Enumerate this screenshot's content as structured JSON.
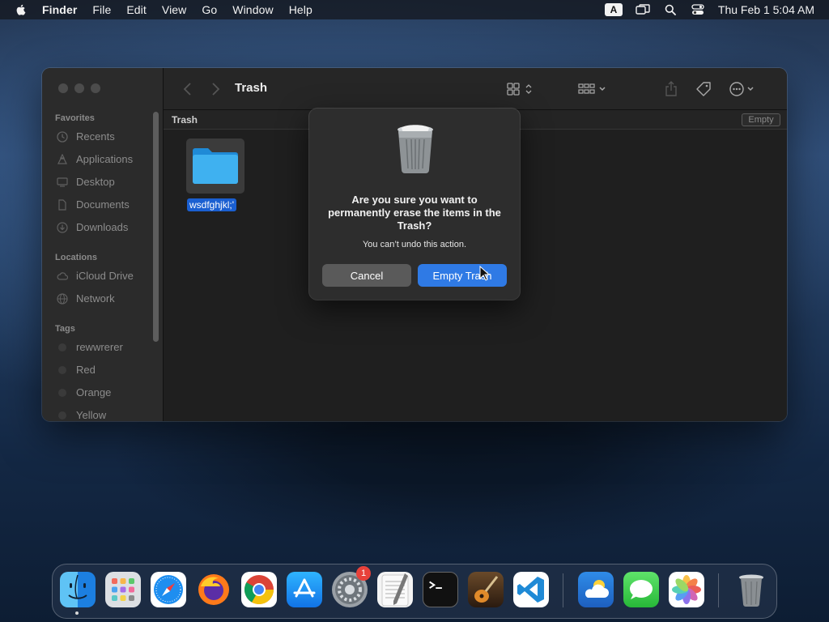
{
  "menubar": {
    "apple_icon": "apple-logo-icon",
    "app_name": "Finder",
    "menus": [
      "File",
      "Edit",
      "View",
      "Go",
      "Window",
      "Help"
    ],
    "input_source": "A",
    "clock": "Thu Feb 1  5:04 AM"
  },
  "window": {
    "title": "Trash",
    "sidebar": {
      "favorites_header": "Favorites",
      "favorites": [
        "Recents",
        "Applications",
        "Desktop",
        "Documents",
        "Downloads"
      ],
      "locations_header": "Locations",
      "locations": [
        "iCloud Drive",
        "Network"
      ],
      "tags_header": "Tags",
      "tags": [
        "rewwrerer",
        "Red",
        "Orange",
        "Yellow"
      ]
    },
    "pathbar": {
      "title": "Trash",
      "empty_label": "Empty"
    },
    "files": [
      {
        "name": "wsdfghjkl;'"
      }
    ]
  },
  "dialog": {
    "title": "Are you sure you want to permanently erase the items in the Trash?",
    "message": "You can’t undo this action.",
    "cancel_label": "Cancel",
    "confirm_label": "Empty Trash"
  },
  "dock": {
    "apps": [
      "Finder",
      "Launchpad",
      "Safari",
      "Firefox",
      "Chrome",
      "App Store",
      "System Settings",
      "TextEdit",
      "Terminal",
      "GarageBand",
      "Visual Studio Code",
      "Weather",
      "Messages",
      "Photos",
      "Trash"
    ],
    "settings_badge": "1"
  },
  "colors": {
    "accent": "#2f7ae5",
    "selection": "#1a5fd1",
    "badge": "#e8413a"
  }
}
